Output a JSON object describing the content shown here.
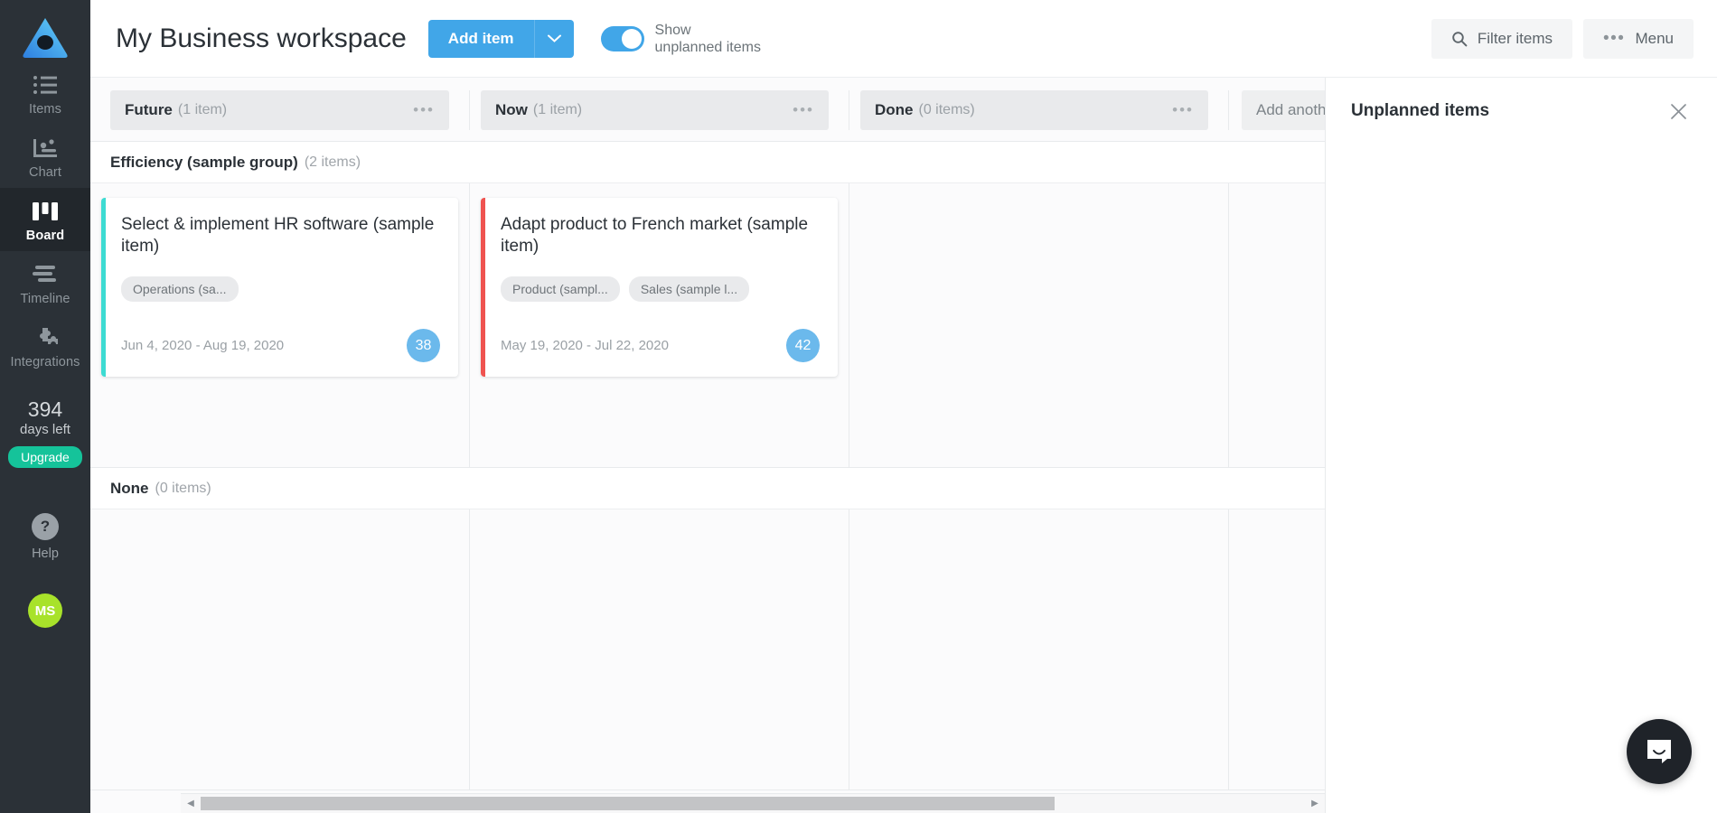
{
  "sidebar": {
    "logo_icon": "toggl-plan-logo",
    "items": [
      {
        "label": "Items",
        "icon": "list-icon",
        "active": false
      },
      {
        "label": "Chart",
        "icon": "chart-icon",
        "active": false
      },
      {
        "label": "Board",
        "icon": "board-icon",
        "active": true
      },
      {
        "label": "Timeline",
        "icon": "timeline-icon",
        "active": false
      },
      {
        "label": "Integrations",
        "icon": "puzzle-icon",
        "active": false
      }
    ],
    "trial": {
      "days": "394",
      "sub": "days left",
      "upgrade_label": "Upgrade"
    },
    "help": {
      "label": "Help",
      "icon": "question-mark-icon"
    },
    "avatar": {
      "initials": "MS"
    }
  },
  "header": {
    "title": "My Business workspace",
    "add_item_label": "Add item",
    "add_item_caret_icon": "chevron-down-icon",
    "toggle": {
      "on": true,
      "label_line1": "Show",
      "label_line2": "unplanned items"
    },
    "filter_label": "Filter items",
    "filter_icon": "search-icon",
    "menu_label": "Menu",
    "menu_icon": "dots-horizontal-icon"
  },
  "board": {
    "columns": [
      {
        "name": "Future",
        "count": "(1 item)"
      },
      {
        "name": "Now",
        "count": "(1 item)"
      },
      {
        "name": "Done",
        "count": "(0 items)"
      }
    ],
    "add_column_label": "Add another column",
    "groups": [
      {
        "name": "Efficiency (sample group)",
        "count": "(2 items)",
        "sort_icon": "sort-updown-icon",
        "lanes": [
          {
            "cards": [
              {
                "title": "Select & implement HR software (sample item)",
                "stripe_color": "#3ddbd2",
                "labels": [
                  "Operations (sa..."
                ],
                "dates": "Jun 4, 2020 - Aug 19, 2020",
                "badge": "38",
                "badge_color": "#6bb9ec"
              }
            ]
          },
          {
            "cards": [
              {
                "title": "Adapt product to French market (sample item)",
                "stripe_color": "#ef5350",
                "labels": [
                  "Product (sampl...",
                  "Sales (sample l..."
                ],
                "dates": "May 19, 2020 - Jul 22, 2020",
                "badge": "42",
                "badge_color": "#46a8e8"
              }
            ]
          },
          {
            "cards": []
          }
        ]
      },
      {
        "name": "None",
        "count": "(0 items)",
        "sort_icon": "sort-updown-icon",
        "lanes": [
          {
            "cards": []
          },
          {
            "cards": []
          },
          {
            "cards": []
          }
        ]
      }
    ]
  },
  "right_panel": {
    "title": "Unplanned items",
    "close_icon": "close-icon"
  },
  "scrollbar": {
    "left_arrow_icon": "triangle-left-icon",
    "right_arrow_icon": "triangle-right-icon"
  },
  "chat": {
    "icon": "chat-bubble-icon"
  },
  "colors": {
    "accent_blue": "#41a6e8",
    "sidebar_bg": "#2b3137",
    "upgrade_green": "#15c39a",
    "avatar_green": "#a8e22a"
  }
}
